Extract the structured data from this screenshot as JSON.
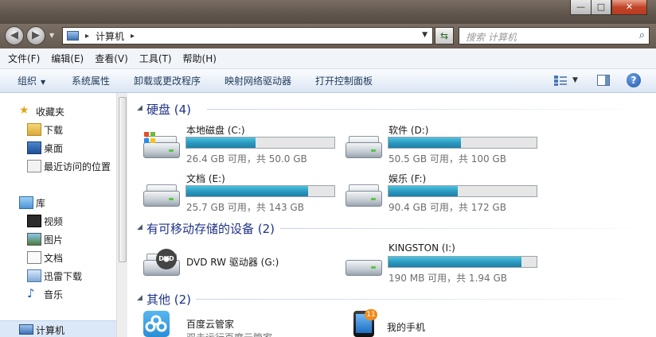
{
  "window": {
    "min_label": "—",
    "max_label": "□",
    "close_label": "✕"
  },
  "nav": {
    "back_glyph": "◀",
    "forward_glyph": "▶",
    "address_text": "计算机",
    "address_sep": "▸",
    "search_placeholder": "搜索 计算机"
  },
  "menu": [
    "文件(F)",
    "编辑(E)",
    "查看(V)",
    "工具(T)",
    "帮助(H)"
  ],
  "commands": {
    "organize": "组织",
    "system_props": "系统属性",
    "uninstall": "卸载或更改程序",
    "map_drive": "映射网络驱动器",
    "control_panel": "打开控制面板"
  },
  "sidebar": {
    "favorites": {
      "label": "收藏夹",
      "items": [
        "下载",
        "桌面",
        "最近访问的位置"
      ]
    },
    "libraries": {
      "label": "库",
      "items": [
        "视频",
        "图片",
        "文档",
        "迅雷下载",
        "音乐"
      ]
    },
    "computer": "计算机"
  },
  "groups": {
    "hdd": "硬盘 (4)",
    "removable": "有可移动存储的设备 (2)",
    "other": "其他 (2)"
  },
  "drives": [
    {
      "name": "本地磁盘 (C:)",
      "info": "26.4 GB 可用，共 50.0 GB",
      "used_fraction": 0.47
    },
    {
      "name": "软件 (D:)",
      "info": "50.5 GB 可用，共 100 GB",
      "used_fraction": 0.49
    },
    {
      "name": "文档 (E:)",
      "info": "25.7 GB 可用，共 143 GB",
      "used_fraction": 0.82
    },
    {
      "name": "娱乐 (F:)",
      "info": "90.4 GB 可用，共 172 GB",
      "used_fraction": 0.47
    }
  ],
  "removable": [
    {
      "name": "DVD RW 驱动器 (G:)"
    },
    {
      "name": "KINGSTON (I:)",
      "info": "190 MB 可用，共 1.94 GB",
      "used_fraction": 0.9
    }
  ],
  "other": [
    {
      "name": "百度云管家",
      "sub": "双击运行百度云管家"
    },
    {
      "name": "我的手机",
      "badge": "11"
    }
  ],
  "colors": {
    "accent": "#1e3287",
    "bar_fill": "#2a97bd"
  }
}
